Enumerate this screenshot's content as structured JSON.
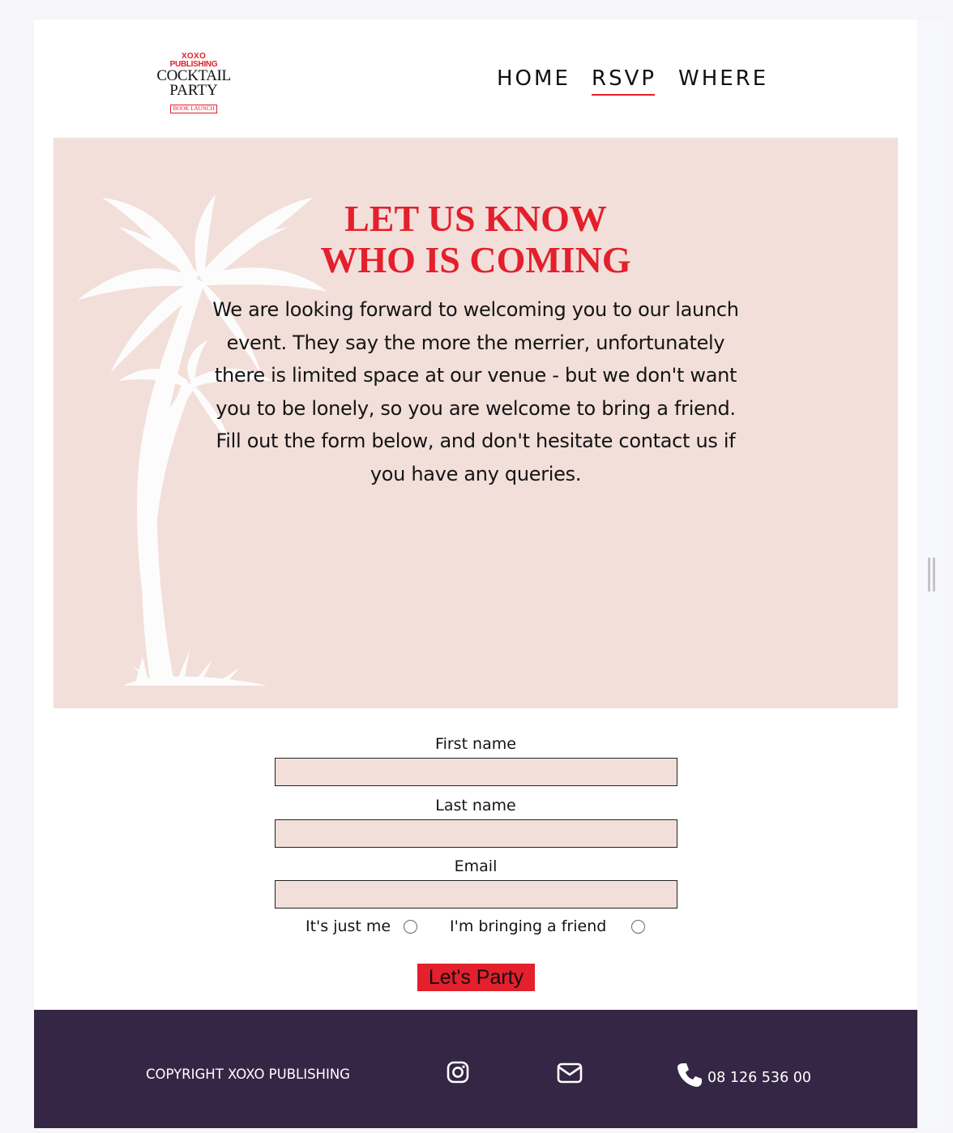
{
  "logo": {
    "line1": "XOXO",
    "line2": "PUBLISHING",
    "line3": "COCKTAIL",
    "line4": "PARTY",
    "line5": "BOOK LAUNCH"
  },
  "nav": {
    "items": [
      {
        "label": "HOME"
      },
      {
        "label": "RSVP",
        "active": true
      },
      {
        "label": "WHERE"
      }
    ],
    "active_underline_color": "#e3202c"
  },
  "hero": {
    "title_line1": "LET US KNOW",
    "title_line2": "WHO IS COMING",
    "text": "We are looking forward to welcoming you to our launch event. They say the more the merrier, unfortunately there is limited space at our venue - but we don't want you to be lonely, so you are welcome to bring a friend. Fill out the form below, and don't hesitate contact us if you have any queries.",
    "background_color": "#f2dfda",
    "title_color": "#e3202c"
  },
  "form": {
    "first_name_label": "First name",
    "first_name_value": "",
    "last_name_label": "Last name",
    "last_name_value": "",
    "email_label": "Email",
    "email_value": "",
    "radio_just_me": "It's just me",
    "radio_friend": "I'm bringing a friend",
    "submit_label": "Let's Party"
  },
  "footer": {
    "copyright": "COPYRIGHT XOXO PUBLISHING",
    "icons": [
      "instagram-icon",
      "envelope-icon",
      "phone-icon"
    ],
    "phone": "08 126 536 00",
    "background_color": "#352645"
  }
}
